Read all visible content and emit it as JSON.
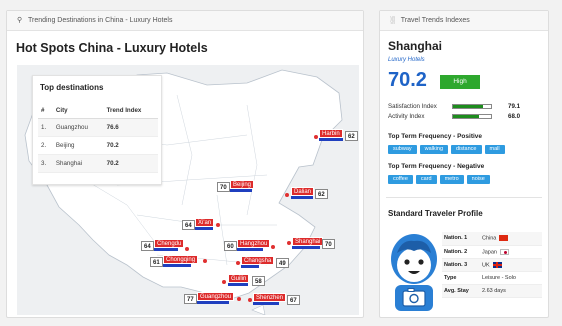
{
  "left_panel": {
    "header": "Trending Destinations in China - Luxury Hotels",
    "title": "Hot Spots China - Luxury Hotels",
    "top_destinations": {
      "title": "Top destinations",
      "columns": [
        "#",
        "City",
        "Trend Index"
      ],
      "rows": [
        {
          "rank": "1.",
          "city": "Guangzhou",
          "value": "76.6"
        },
        {
          "rank": "2.",
          "city": "Beijing",
          "value": "70.2"
        },
        {
          "rank": "3.",
          "city": "Shanghai",
          "value": "70.2"
        }
      ]
    },
    "map_cities": [
      {
        "name": "Harbin",
        "value": "62"
      },
      {
        "name": "Beijing",
        "value": "70"
      },
      {
        "name": "Dalian",
        "value": "62"
      },
      {
        "name": "Xi'an",
        "value": "64"
      },
      {
        "name": "Chengdu",
        "value": "64"
      },
      {
        "name": "Hangzhou",
        "value": "60"
      },
      {
        "name": "Shanghai",
        "value": "70"
      },
      {
        "name": "Chongqing",
        "value": "61"
      },
      {
        "name": "Changsha",
        "value": "49"
      },
      {
        "name": "Guilin",
        "value": "58"
      },
      {
        "name": "Guangzhou",
        "value": "77"
      },
      {
        "name": "Shenzhen",
        "value": "67"
      }
    ]
  },
  "right_panel": {
    "header": "Travel Trends Indexes",
    "city": "Shanghai",
    "segment": "Luxury Hotels",
    "score": "70.2",
    "score_badge": "High",
    "colors": {
      "accent": "#1e63c7",
      "high": "#2ea82e",
      "tag": "#2e9be0",
      "marker": "#dd2b2b"
    },
    "indexes": [
      {
        "label": "Satisfaction Index",
        "value": "79.1",
        "fraction": 0.791
      },
      {
        "label": "Activity Index",
        "value": "68.0",
        "fraction": 0.68
      }
    ],
    "positive_title": "Top Term Frequency - Positive",
    "positive_terms": [
      "subway",
      "walking",
      "distance",
      "mall"
    ],
    "negative_title": "Top Term Frequency - Negative",
    "negative_terms": [
      "coffee",
      "card",
      "metro",
      "noise"
    ],
    "profile": {
      "title": "Standard Traveler Profile",
      "rows": [
        {
          "key": "Nation. 1",
          "value": "China",
          "flag": "cn"
        },
        {
          "key": "Nation. 2",
          "value": "Japan",
          "flag": "jp"
        },
        {
          "key": "Nation. 3",
          "value": "UK",
          "flag": "uk"
        },
        {
          "key": "Type",
          "value": "Leisure - Solo"
        },
        {
          "key": "Avg. Stay",
          "value": "2.63 days"
        }
      ]
    }
  }
}
